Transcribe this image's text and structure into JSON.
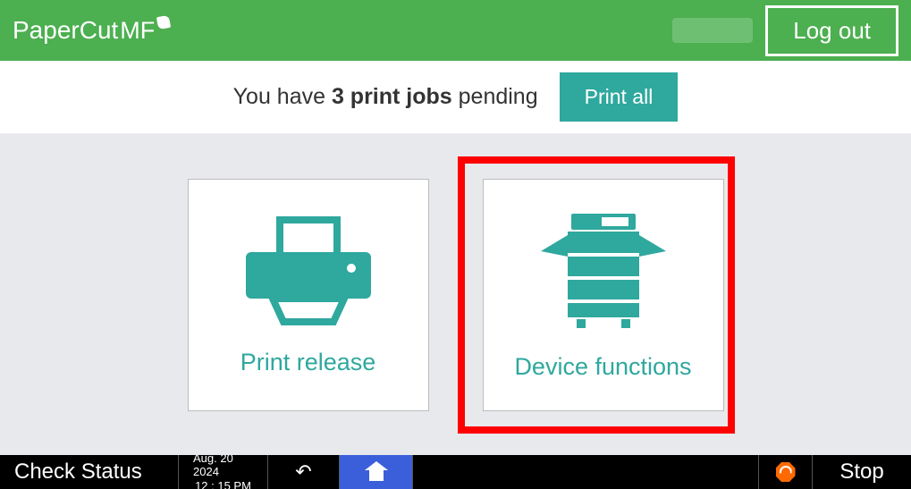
{
  "header": {
    "brand_a": "Paper",
    "brand_b": "Cut",
    "brand_suffix": "MF",
    "logout_label": "Log out"
  },
  "pending": {
    "prefix": "You have ",
    "count_phrase": "3 print jobs",
    "suffix": " pending",
    "print_all_label": "Print all"
  },
  "tiles": {
    "print_release": "Print release",
    "device_functions": "Device functions"
  },
  "bottom": {
    "check_status": "Check Status",
    "date_line1": "Aug. 20 2024",
    "date_line2": "12 : 15 PM",
    "stop": "Stop"
  }
}
